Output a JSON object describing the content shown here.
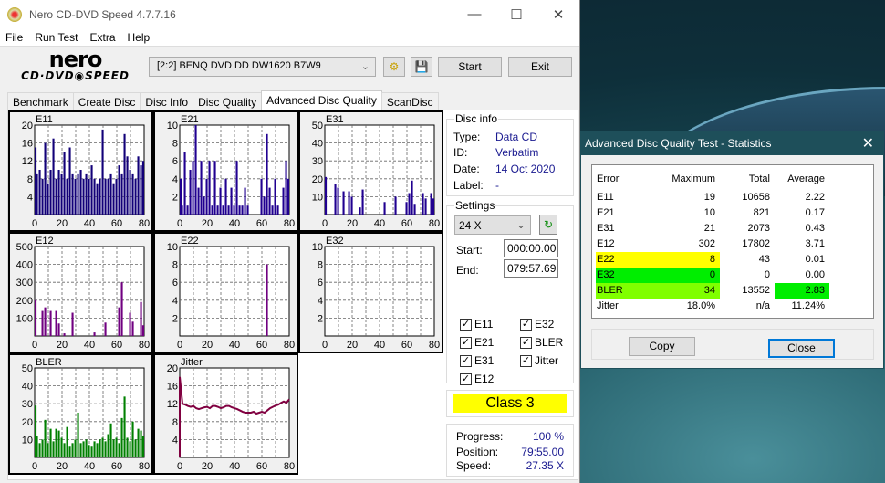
{
  "app": {
    "title": "Nero CD-DVD Speed 4.7.7.16",
    "logo_top": "nero",
    "logo_bottom": "CD·DVD SPEED"
  },
  "menu": [
    "File",
    "Run Test",
    "Extra",
    "Help"
  ],
  "toolbar": {
    "drive": "[2:2]  BENQ DVD DD DW1620 B7W9",
    "start": "Start",
    "exit": "Exit"
  },
  "tabs": [
    "Benchmark",
    "Create Disc",
    "Disc Info",
    "Disc Quality",
    "Advanced Disc Quality",
    "ScanDisc"
  ],
  "active_tab": "Advanced Disc Quality",
  "disc_info": {
    "title": "Disc info",
    "type_label": "Type:",
    "type": "Data CD",
    "id_label": "ID:",
    "id": "Verbatim",
    "date_label": "Date:",
    "date": "14 Oct 2020",
    "label_label": "Label:",
    "label": "-"
  },
  "settings": {
    "title": "Settings",
    "speed": "24 X",
    "start_label": "Start:",
    "start": "000:00.00",
    "end_label": "End:",
    "end": "079:57.69",
    "checks": [
      {
        "label": "E11",
        "checked": true
      },
      {
        "label": "E21",
        "checked": true
      },
      {
        "label": "E31",
        "checked": true
      },
      {
        "label": "E12",
        "checked": true
      },
      {
        "label": "E22",
        "checked": true
      },
      {
        "label": "E32",
        "checked": true
      },
      {
        "label": "BLER",
        "checked": true
      },
      {
        "label": "Jitter",
        "checked": true
      }
    ]
  },
  "class": {
    "label": "Class 3",
    "color": "#ffff00"
  },
  "progress": {
    "progress_label": "Progress:",
    "progress": "100 %",
    "position_label": "Position:",
    "position": "79:55.00",
    "speed_label": "Speed:",
    "speed": "27.35 X"
  },
  "stats": {
    "title": "Advanced Disc Quality Test - Statistics",
    "headers": [
      "Error",
      "Maximum",
      "Total",
      "Average"
    ],
    "rows": [
      {
        "name": "E11",
        "max": "19",
        "total": "10658",
        "avg": "2.22"
      },
      {
        "name": "E21",
        "max": "10",
        "total": "821",
        "avg": "0.17"
      },
      {
        "name": "E31",
        "max": "21",
        "total": "2073",
        "avg": "0.43"
      },
      {
        "name": "E12",
        "max": "302",
        "total": "17802",
        "avg": "3.71"
      },
      {
        "name": "E22",
        "max": "8",
        "total": "43",
        "avg": "0.01",
        "highlight": "#ffff00"
      },
      {
        "name": "E32",
        "max": "0",
        "total": "0",
        "avg": "0.00",
        "highlight": "#00ee00"
      },
      {
        "name": "BLER",
        "max": "34",
        "total": "13552",
        "avg": "2.83",
        "highlight": "#80ff00",
        "avg_highlight": "#00ee00"
      },
      {
        "name": "Jitter",
        "max": "18.0%",
        "total": "n/a",
        "avg": "11.24%"
      }
    ],
    "copy": "Copy",
    "close": "Close"
  },
  "chart_data": [
    {
      "type": "bar",
      "title": "E11",
      "color": "#120078",
      "xlim": [
        0,
        80
      ],
      "ylim": [
        0,
        20
      ],
      "xticks": [
        "0",
        "20",
        "40",
        "60",
        "80"
      ],
      "yticks": [
        "4",
        "8",
        "12",
        "16",
        "20"
      ],
      "grid": true,
      "x_step": 2,
      "values": [
        15,
        9,
        10,
        8,
        16,
        7,
        10,
        17,
        8,
        10,
        9,
        14,
        8,
        15,
        9,
        8,
        9,
        10,
        8,
        9,
        8,
        11,
        8,
        7,
        8,
        19,
        8,
        8,
        9,
        7,
        8,
        11,
        9,
        18,
        13,
        10,
        9,
        8,
        13,
        11,
        12
      ]
    },
    {
      "type": "bar",
      "title": "E21",
      "color": "#200090",
      "xlim": [
        0,
        80
      ],
      "ylim": [
        0,
        10
      ],
      "xticks": [
        "0",
        "20",
        "40",
        "60",
        "80"
      ],
      "yticks": [
        "2",
        "4",
        "6",
        "8",
        "10"
      ],
      "grid": true,
      "x_step": 2,
      "values": [
        4,
        1,
        7,
        1,
        5,
        6,
        10,
        3,
        6,
        2,
        4,
        6,
        1,
        6,
        1,
        3,
        1,
        4,
        1,
        3,
        1,
        6,
        1,
        1,
        3,
        1,
        0,
        0,
        0,
        0,
        4,
        2,
        9,
        3,
        1,
        4,
        1,
        0,
        3,
        6,
        4
      ]
    },
    {
      "type": "bar",
      "title": "E31",
      "color": "#200090",
      "xlim": [
        0,
        80
      ],
      "ylim": [
        0,
        50
      ],
      "xticks": [
        "0",
        "20",
        "40",
        "60",
        "80"
      ],
      "yticks": [
        "10",
        "20",
        "30",
        "40",
        "50"
      ],
      "grid": true,
      "x_step": 2,
      "values": [
        21,
        0,
        0,
        0,
        17,
        15,
        0,
        13,
        0,
        13,
        10,
        0,
        0,
        4,
        14,
        0,
        0,
        0,
        0,
        0,
        0,
        0,
        7,
        0,
        0,
        0,
        10,
        0,
        0,
        0,
        7,
        12,
        19,
        6,
        0,
        0,
        12,
        9,
        0,
        12,
        9
      ]
    },
    {
      "type": "bar",
      "title": "E12",
      "color": "#700080",
      "xlim": [
        0,
        80
      ],
      "ylim": [
        0,
        500
      ],
      "xticks": [
        "0",
        "20",
        "40",
        "60",
        "80"
      ],
      "yticks": [
        "100",
        "200",
        "300",
        "400",
        "500"
      ],
      "grid": true,
      "x_step": 2,
      "values": [
        200,
        0,
        0,
        140,
        160,
        0,
        140,
        0,
        140,
        70,
        0,
        15,
        0,
        0,
        130,
        0,
        0,
        0,
        0,
        0,
        0,
        0,
        20,
        0,
        0,
        0,
        75,
        0,
        0,
        0,
        0,
        160,
        300,
        0,
        0,
        130,
        80,
        0,
        0,
        190,
        60
      ]
    },
    {
      "type": "bar",
      "title": "E22",
      "color": "#700080",
      "xlim": [
        0,
        80
      ],
      "ylim": [
        0,
        10
      ],
      "xticks": [
        "0",
        "20",
        "40",
        "60",
        "80"
      ],
      "yticks": [
        "2",
        "4",
        "6",
        "8",
        "10"
      ],
      "grid": true,
      "x_step": 2,
      "values": [
        0,
        0,
        0,
        0,
        0,
        0,
        0,
        0,
        0,
        0,
        0,
        0,
        0,
        0,
        0,
        0,
        0,
        0,
        0,
        0,
        0,
        0,
        0,
        0,
        0,
        0,
        0,
        0,
        0,
        0,
        0,
        0,
        8,
        0,
        0,
        0,
        0,
        0,
        0,
        0,
        0
      ]
    },
    {
      "type": "bar",
      "title": "E32",
      "color": "#700080",
      "xlim": [
        0,
        80
      ],
      "ylim": [
        0,
        10
      ],
      "xticks": [
        "0",
        "20",
        "40",
        "60",
        "80"
      ],
      "yticks": [
        "2",
        "4",
        "6",
        "8",
        "10"
      ],
      "grid": true,
      "x_step": 2,
      "values": [
        0,
        0,
        0,
        0,
        0,
        0,
        0,
        0,
        0,
        0,
        0,
        0,
        0,
        0,
        0,
        0,
        0,
        0,
        0,
        0,
        0,
        0,
        0,
        0,
        0,
        0,
        0,
        0,
        0,
        0,
        0,
        0,
        0,
        0,
        0,
        0,
        0,
        0,
        0,
        0,
        0
      ]
    },
    {
      "type": "bar",
      "title": "BLER",
      "color": "#008000",
      "xlim": [
        0,
        80
      ],
      "ylim": [
        0,
        50
      ],
      "xticks": [
        "0",
        "20",
        "40",
        "60",
        "80"
      ],
      "yticks": [
        "10",
        "20",
        "30",
        "40",
        "50"
      ],
      "grid": true,
      "x_step": 2,
      "values": [
        29,
        12,
        8,
        10,
        21,
        8,
        16,
        9,
        16,
        15,
        11,
        8,
        17,
        6,
        8,
        10,
        25,
        8,
        9,
        10,
        7,
        6,
        9,
        8,
        10,
        11,
        9,
        13,
        19,
        10,
        11,
        8,
        22,
        34,
        11,
        9,
        20,
        10,
        16,
        15,
        12
      ]
    },
    {
      "type": "line",
      "title": "Jitter",
      "color": "#800040",
      "xlim": [
        0,
        80
      ],
      "ylim": [
        0,
        20
      ],
      "xticks": [
        "0",
        "20",
        "40",
        "60",
        "80"
      ],
      "yticks": [
        "4",
        "8",
        "12",
        "16",
        "20"
      ],
      "grid": true,
      "x_step": 2,
      "values": [
        18,
        12,
        11.8,
        11.5,
        11.3,
        11.5,
        11,
        10.8,
        11,
        11.2,
        11.3,
        11,
        11.5,
        11.5,
        11.3,
        11,
        11.2,
        11.5,
        11.5,
        11.2,
        11,
        10.8,
        10.5,
        10.2,
        10,
        10,
        10,
        10.2,
        9.8,
        10,
        10.2,
        10,
        10.5,
        11,
        11.3,
        11.6,
        11.8,
        12.2,
        12.5,
        12.2,
        13
      ]
    }
  ]
}
